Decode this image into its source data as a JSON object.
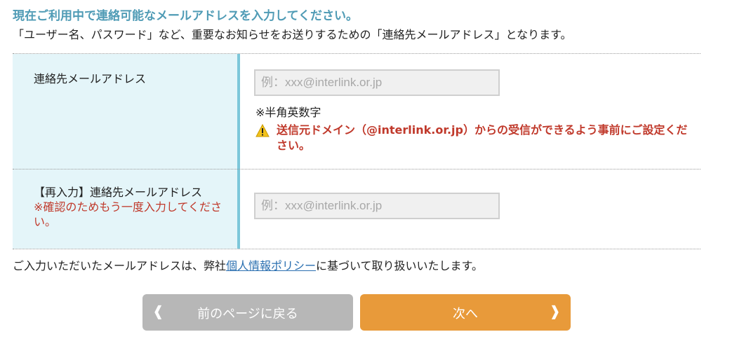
{
  "heading": "現在ご利用中で連絡可能なメールアドレスを入力してください。",
  "intro": "「ユーザー名、パスワード」など、重要なお知らせをお送りするための「連絡先メールアドレス」となります。",
  "form": {
    "email": {
      "label": "連絡先メールアドレス",
      "placeholder": "例：xxx@interlink.or.jp",
      "value": "",
      "hint": "※半角英数字",
      "warning": "送信元ドメイン（@interlink.or.jp）からの受信ができるよう事前にご設定ください。"
    },
    "email_confirm": {
      "label": "【再入力】連絡先メールアドレス",
      "note": "※確認のためもう一度入力してください。",
      "placeholder": "例：xxx@interlink.or.jp",
      "value": ""
    }
  },
  "policy": {
    "prefix": "ご入力いただいたメールアドレスは、弊社",
    "link": "個人情報ポリシー",
    "suffix": "に基づいて取り扱いいたします。"
  },
  "buttons": {
    "back": {
      "label": "前のページに戻る",
      "chevron": "❰"
    },
    "next": {
      "label": "次へ",
      "chevron": "❱"
    }
  },
  "colors": {
    "accent": "#4f9bb5",
    "error": "#c0392b",
    "next_button": "#e89a3a",
    "back_button": "#b7b7b7"
  }
}
